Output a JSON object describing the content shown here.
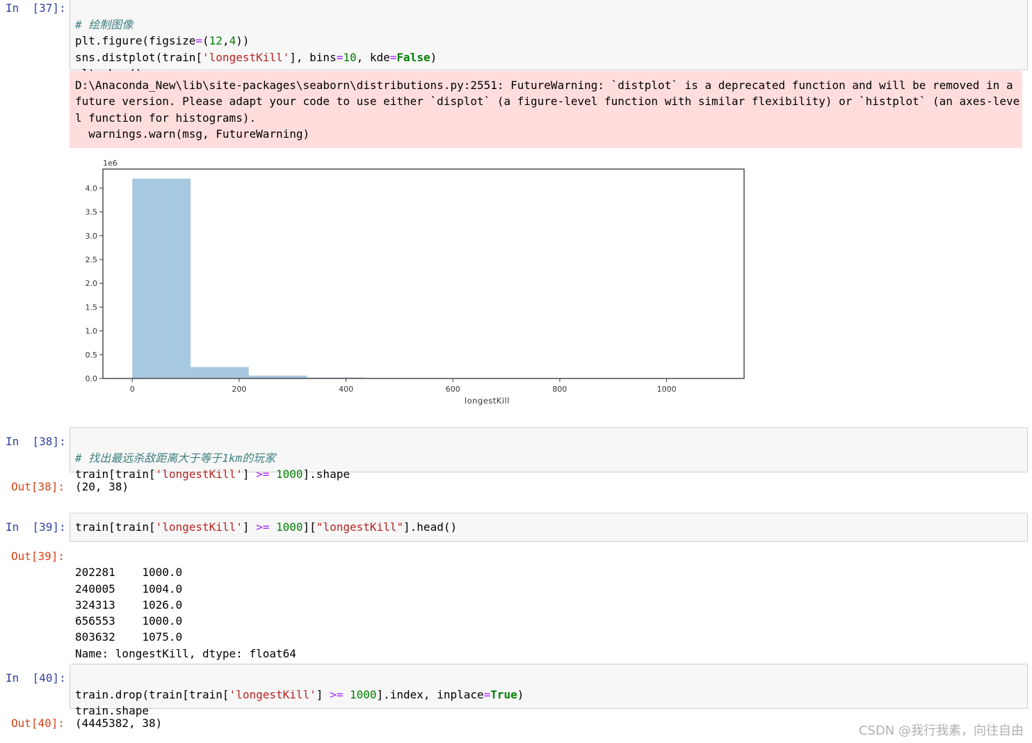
{
  "cells": {
    "c37": {
      "prompt": "In  [37]:",
      "comment": "# 绘制图像",
      "line2_a": "plt.figure(figsize",
      "line2_b": "=",
      "line2_c": "(",
      "line2_d": "12",
      "line2_e": ",",
      "line2_f": "4",
      "line2_g": "))",
      "line3_a": "sns.distplot(train[",
      "line3_b": "'longestKill'",
      "line3_c": "], bins",
      "line3_d": "=",
      "line3_e": "10",
      "line3_f": ", kde",
      "line3_g": "=",
      "line3_h": "False",
      "line3_i": ")",
      "line4": "plt.show()",
      "stderr": "D:\\Anaconda_New\\lib\\site-packages\\seaborn\\distributions.py:2551: FutureWarning: `distplot` is a deprecated function and will be removed in a future version. Please adapt your code to use either `displot` (a figure-level function with similar flexibility) or `histplot` (an axes-level function for histograms).\n  warnings.warn(msg, FutureWarning)"
    },
    "c38": {
      "prompt_in": "In  [38]:",
      "comment": "# 找出最远杀敌距离大于等于1km的玩家",
      "line2_a": "train[train[",
      "line2_b": "'longestKill'",
      "line2_c": "] ",
      "line2_d": ">=",
      "line2_e": " ",
      "line2_f": "1000",
      "line2_g": "].shape",
      "prompt_out": "Out[38]:",
      "output": "(20, 38)"
    },
    "c39": {
      "prompt_in": "In  [39]:",
      "line1_a": "train[train[",
      "line1_b": "'longestKill'",
      "line1_c": "] ",
      "line1_d": ">=",
      "line1_e": " ",
      "line1_f": "1000",
      "line1_g": "][",
      "line1_h": "\"longestKill\"",
      "line1_i": "].head()",
      "prompt_out": "Out[39]:",
      "output_rows": [
        {
          "index": "202281",
          "value": "1000.0"
        },
        {
          "index": "240005",
          "value": "1004.0"
        },
        {
          "index": "324313",
          "value": "1026.0"
        },
        {
          "index": "656553",
          "value": "1000.0"
        },
        {
          "index": "803632",
          "value": "1075.0"
        }
      ],
      "output_footer": "Name: longestKill, dtype: float64"
    },
    "c40": {
      "prompt_in": "In  [40]:",
      "line1_a": "train.drop(train[train[",
      "line1_b": "'longestKill'",
      "line1_c": "] ",
      "line1_d": ">=",
      "line1_e": " ",
      "line1_f": "1000",
      "line1_g": "].index, inplace",
      "line1_h": "=",
      "line1_i": "True",
      "line1_j": ")",
      "line2": "train.shape",
      "prompt_out": "Out[40]:",
      "output": "(4445382, 38)"
    }
  },
  "watermark": "CSDN @我行我素，向往自由",
  "colors": {
    "bar_fill": "#a6c8e0",
    "stderr_bg": "#ffdddd",
    "prompt_in": "#303f9f",
    "prompt_out": "#d84315"
  },
  "chart_data": {
    "type": "bar",
    "title": "",
    "xlabel": "longestKill",
    "ylabel": "",
    "y_offset_label": "1e6",
    "x_ticks": [
      "0",
      "200",
      "400",
      "600",
      "800",
      "1000"
    ],
    "y_ticks": [
      "0.0",
      "0.5",
      "1.0",
      "1.5",
      "2.0",
      "2.5",
      "3.0",
      "3.5",
      "4.0"
    ],
    "xlim": [
      -55,
      1145
    ],
    "ylim": [
      0,
      4.4
    ],
    "bins": [
      {
        "x0": 0,
        "x1": 109,
        "value": 4.2
      },
      {
        "x0": 109,
        "x1": 218,
        "value": 0.24
      },
      {
        "x0": 218,
        "x1": 327,
        "value": 0.06
      },
      {
        "x0": 327,
        "x1": 436,
        "value": 0.02
      }
    ],
    "grid": false,
    "legend": "none"
  }
}
